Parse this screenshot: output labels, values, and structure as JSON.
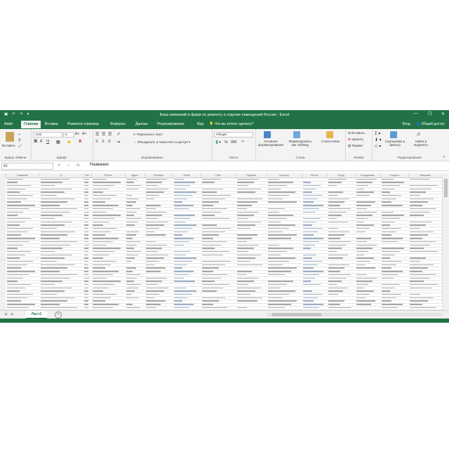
{
  "title_bar": {
    "title": "База компаний и фирм по ремонту и отделке помещений Россия - Excel",
    "minimize": "—",
    "restore": "❐",
    "close": "✕"
  },
  "ribbon_tabs": {
    "tabs": [
      "Файл",
      "Главная",
      "Вставка",
      "Разметка страницы",
      "Формулы",
      "Данные",
      "Рецензирование",
      "Вид"
    ],
    "search": "Что вы хотите сделать?",
    "sign_in": "Вход",
    "share": "Общий доступ"
  },
  "ribbon": {
    "clipboard": {
      "paste": "Вставить",
      "label": "Буфер обмена"
    },
    "font": {
      "name": "Arial",
      "size": "8",
      "bold": "Ж",
      "italic": "К",
      "underline": "Ч",
      "label": "Шрифт"
    },
    "alignment": {
      "wrap": "Переносить текст",
      "merge": "Объединить и поместить в центре",
      "label": "Выравнивание"
    },
    "number": {
      "format": "Общий",
      "label": "Число"
    },
    "styles": {
      "conditional": "Условное форматирование",
      "as_table": "Форматировать как таблицу",
      "cell_styles": "Стили ячеек",
      "label": "Стили"
    },
    "cells": {
      "insert": "Вставить",
      "delete": "Удалить",
      "format": "Формат",
      "label": "Ячейки"
    },
    "editing": {
      "sort": "Сортировка и фильтр",
      "find": "Найти и выделить",
      "label": "Редактирование"
    }
  },
  "formula_bar": {
    "name_box": "A1",
    "cancel": "✕",
    "enter": "✓",
    "fx": "fx",
    "value": "Название"
  },
  "columns": [
    "Название",
    "Д",
    "Тип",
    "Регион",
    "Адрес",
    "Телефон",
    "Email",
    "Сайт",
    "Рубрика",
    "Отрасль",
    "Регион",
    "Город",
    "Координаты",
    "Соцсети",
    "Описание"
  ],
  "sheet": {
    "tab": "Лист1",
    "add": "+"
  },
  "accent": "#217346"
}
